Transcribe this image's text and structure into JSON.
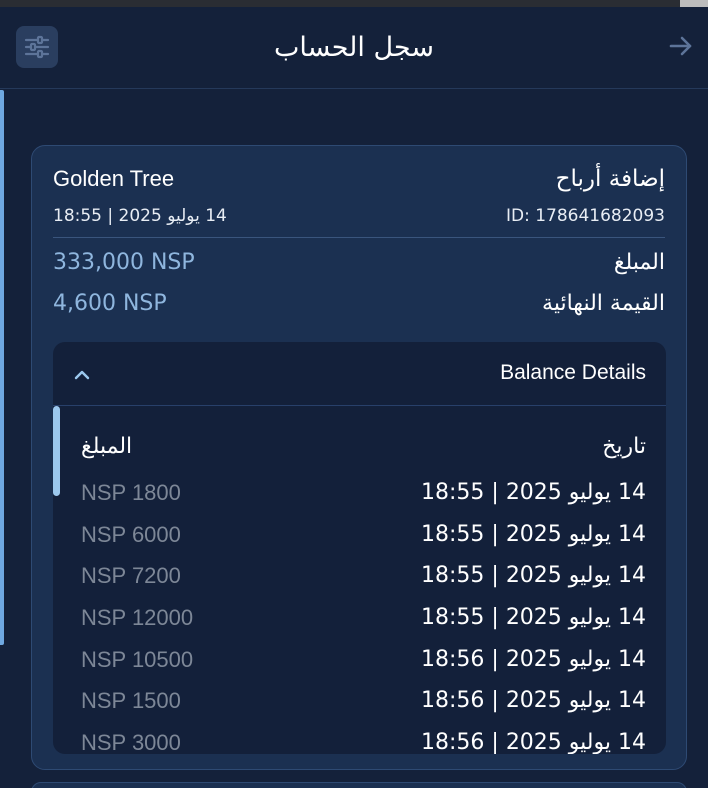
{
  "header": {
    "title": "سجل الحساب",
    "filter_icon": "sliders-icon",
    "back_icon": "arrow-right-icon"
  },
  "transaction": {
    "type": "إضافة أرباح",
    "merchant": "Golden Tree",
    "id": "ID: 178641682093",
    "date": "14 يوليو 2025 | 18:55",
    "amount_label": "المبلغ",
    "amount_value": "333,000 NSP",
    "final_label": "القيمة النهائية",
    "final_value": "4,600 NSP"
  },
  "balance_details": {
    "title": "Balance Details",
    "expanded": true,
    "col_date": "تاريخ",
    "col_amount": "المبلغ",
    "rows": [
      {
        "date": "14 يوليو 2025 | 18:55",
        "amount": "NSP 1800"
      },
      {
        "date": "14 يوليو 2025 | 18:55",
        "amount": "NSP 6000"
      },
      {
        "date": "14 يوليو 2025 | 18:55",
        "amount": "NSP 7200"
      },
      {
        "date": "14 يوليو 2025 | 18:55",
        "amount": "NSP 12000"
      },
      {
        "date": "14 يوليو 2025 | 18:56",
        "amount": "NSP 10500"
      },
      {
        "date": "14 يوليو 2025 | 18:56",
        "amount": "NSP 1500"
      },
      {
        "date": "14 يوليو 2025 | 18:56",
        "amount": "NSP 3000"
      }
    ]
  },
  "colors": {
    "background": "#14213a",
    "card": "#1b3051",
    "details_panel": "#13203a",
    "accent_value": "#8fb6de",
    "muted_amount": "#7d8797",
    "scroll_thumb": "#9cc8ee"
  }
}
